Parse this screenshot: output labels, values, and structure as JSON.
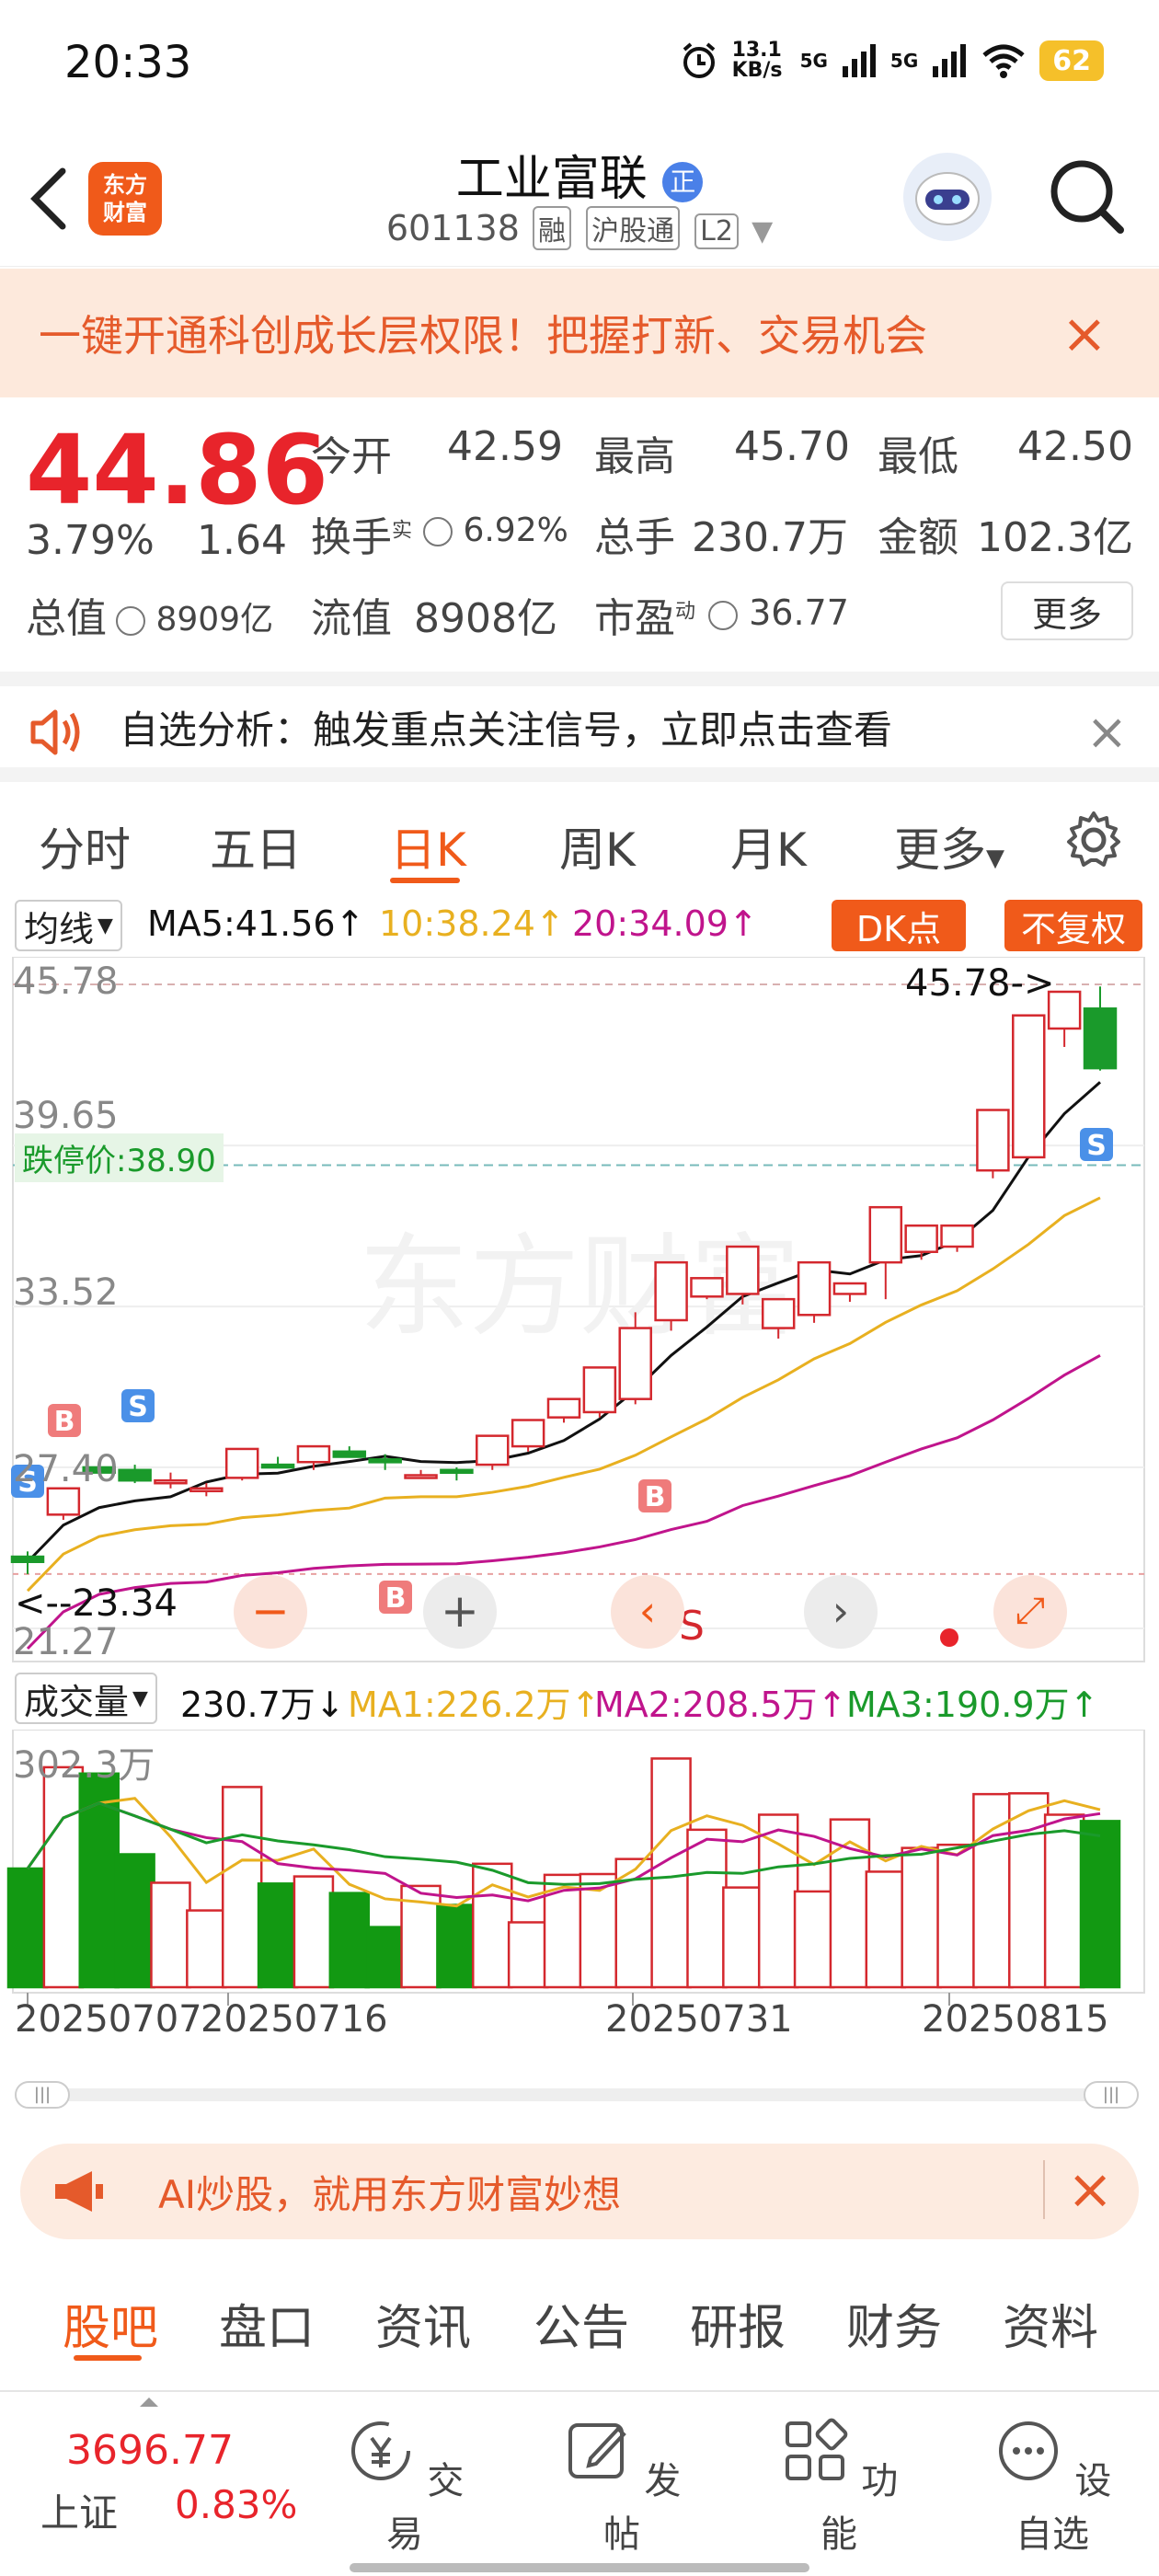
{
  "status_bar": {
    "time": "20:33",
    "net_speed": "13.1 KB/s",
    "signal1": "5G",
    "signal2": "5G",
    "battery": "62"
  },
  "header": {
    "logo_line1": "东方",
    "logo_line2": "财富",
    "title": "工业富联",
    "code": "601138",
    "tag1": "融",
    "tag2": "沪股通",
    "tag3": "L2"
  },
  "banner": {
    "text": "一键开通科创成长层权限！把握打新、交易机会",
    "close": "×"
  },
  "quote": {
    "price": "44.86",
    "change_pct": "3.79%",
    "change": "1.64",
    "open_label": "今开",
    "open": "42.59",
    "high_label": "最高",
    "high": "45.70",
    "low_label": "最低",
    "low": "42.50",
    "turnover_label": "换手",
    "turnover_sup": "实",
    "turnover": "6.92%",
    "volume_label": "总手",
    "volume": "230.7万",
    "amount_label": "金额",
    "amount": "102.3亿",
    "total_cap_label": "总值",
    "total_cap": "8909亿",
    "float_cap_label": "流值",
    "float_cap": "8908亿",
    "pe_label": "市盈",
    "pe_sup": "动",
    "pe": "36.77",
    "more": "更多"
  },
  "analysis": {
    "text": "自选分析：触发重点关注信号，立即点击查看"
  },
  "tabs": [
    "分时",
    "五日",
    "日K",
    "周K",
    "月K",
    "更多"
  ],
  "ma_line": {
    "type": "均线",
    "ma5": "MA5:41.56",
    "ma10": "10:38.24",
    "ma20": "20:34.09",
    "dk": "DK点",
    "adjust": "不复权"
  },
  "chart": {
    "y_labels": [
      "45.78",
      "39.65",
      "33.52",
      "27.40",
      "21.27"
    ],
    "high_mark": "45.78->",
    "limit_down": "跌停价:38.90",
    "low_mark": "<--23.34",
    "watermark": "东方财富",
    "x_labels": [
      "20250707",
      "20250716",
      "20250731",
      "20250815"
    ],
    "vol_top": "302.3万"
  },
  "vol_line": {
    "label": "成交量",
    "value": "230.7万",
    "ma1": "MA1:226.2万",
    "ma2": "MA2:208.5万",
    "ma3": "MA3:190.9万"
  },
  "chart_data": {
    "type": "candlestick",
    "y_range": [
      21.27,
      45.78
    ],
    "ohlc": [
      [
        24.0,
        24.2,
        23.34,
        23.8
      ],
      [
        25.6,
        26.5,
        25.4,
        26.6
      ],
      [
        27.4,
        27.6,
        27.3,
        27.2
      ],
      [
        27.3,
        27.5,
        26.8,
        26.9
      ],
      [
        26.9,
        27.2,
        26.6,
        26.9
      ],
      [
        26.5,
        26.8,
        26.3,
        26.6
      ],
      [
        27.0,
        28.0,
        26.9,
        28.1
      ],
      [
        27.5,
        27.8,
        27.4,
        27.4
      ],
      [
        27.6,
        28.1,
        27.3,
        28.2
      ],
      [
        28.0,
        28.2,
        27.8,
        27.8
      ],
      [
        27.7,
        27.9,
        27.3,
        27.6
      ],
      [
        27.1,
        27.3,
        27.0,
        27.1
      ],
      [
        27.3,
        27.4,
        26.9,
        27.2
      ],
      [
        27.5,
        28.4,
        27.3,
        28.6
      ],
      [
        28.2,
        28.6,
        28.0,
        29.2
      ],
      [
        29.3,
        29.7,
        29.1,
        30.0
      ],
      [
        29.5,
        30.8,
        29.3,
        31.2
      ],
      [
        30.0,
        33.3,
        29.8,
        32.7
      ],
      [
        33.0,
        34.5,
        32.6,
        35.2
      ],
      [
        33.9,
        34.6,
        33.8,
        34.6
      ],
      [
        34.0,
        35.2,
        33.6,
        35.8
      ],
      [
        32.7,
        33.4,
        32.3,
        33.8
      ],
      [
        33.2,
        34.7,
        32.9,
        35.2
      ],
      [
        34.0,
        34.3,
        33.7,
        34.4
      ],
      [
        35.2,
        35.8,
        33.8,
        37.3
      ],
      [
        35.6,
        36.4,
        35.3,
        36.6
      ],
      [
        35.8,
        36.1,
        35.6,
        36.6
      ],
      [
        38.7,
        40.8,
        38.4,
        41.0
      ],
      [
        39.2,
        44.4,
        39.2,
        44.6
      ],
      [
        44.1,
        44.2,
        43.4,
        45.5
      ],
      [
        44.86,
        45.7,
        42.5,
        42.59
      ]
    ],
    "volume": [
      150,
      278,
      270,
      168,
      132,
      97,
      253,
      131,
      140,
      119,
      76,
      128,
      104,
      156,
      82,
      142,
      143,
      162,
      289,
      199,
      126,
      218,
      121,
      212,
      146,
      176,
      180,
      244,
      245,
      218,
      210
    ],
    "volume_max": 302.3
  },
  "ai_bar": {
    "text": "AI炒股，就用东方财富妙想"
  },
  "section_tabs": [
    "股吧",
    "盘口",
    "资讯",
    "公告",
    "研报",
    "财务",
    "资料"
  ],
  "bottom_nav": {
    "index_value": "3696.77",
    "index_name": "上证",
    "index_pct": "0.83%",
    "trade": "交易",
    "post": "发帖",
    "func": "功能",
    "watch": "设自选"
  }
}
